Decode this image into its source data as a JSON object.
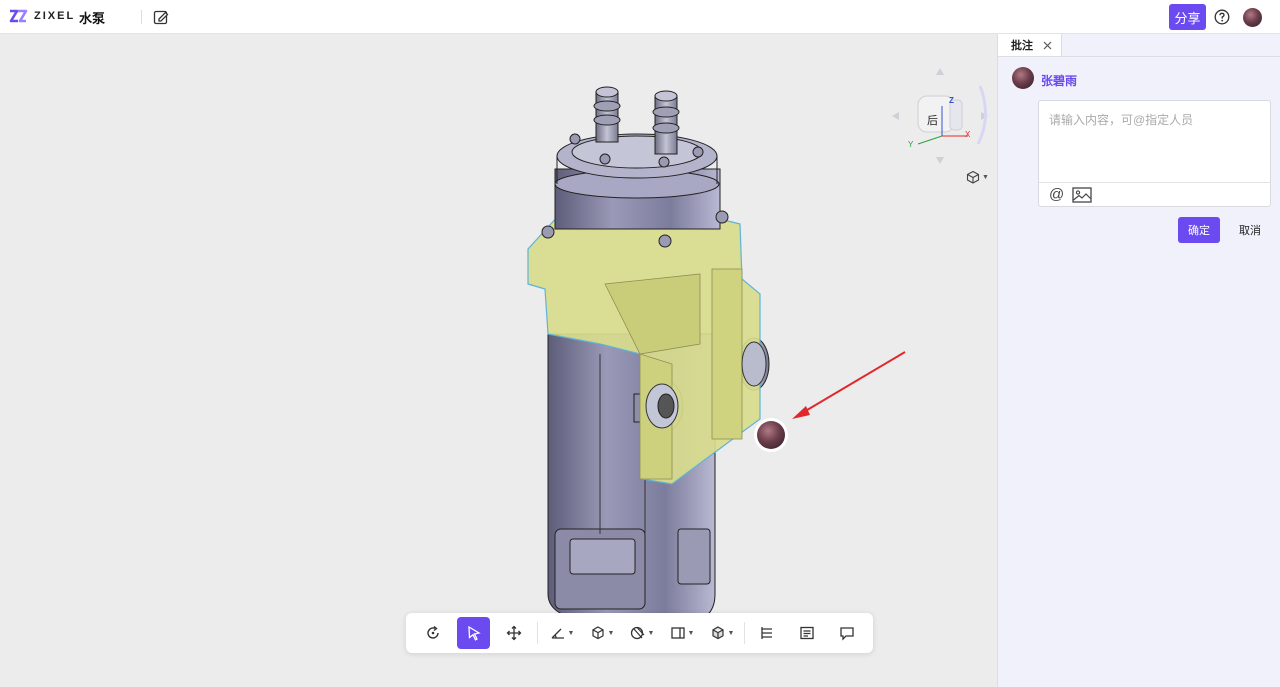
{
  "header": {
    "brand": "ZIXEL",
    "doc_title": "水泵",
    "share_label": "分享"
  },
  "viewcube": {
    "face_label": "后",
    "axis_x": "X",
    "axis_y": "Y",
    "axis_z": "Z"
  },
  "panel": {
    "tab_label": "批注",
    "user_name": "张碧雨",
    "comment_placeholder": "请输入内容，可@指定人员",
    "at_label": "@",
    "confirm_label": "确定",
    "cancel_label": "取消"
  },
  "toolbar": {
    "tools": [
      "rotate-tool",
      "select-tool",
      "pan-tool",
      "measure-tool",
      "explode-tool",
      "section-tool",
      "view-tool",
      "display-mode-tool",
      "structure-tree-tool",
      "properties-tool",
      "comment-tool"
    ],
    "active_tool": "select-tool"
  },
  "colors": {
    "accent": "#6b4bf0",
    "highlight": "#d8dc8c",
    "annotation_arrow": "#e0282b"
  }
}
